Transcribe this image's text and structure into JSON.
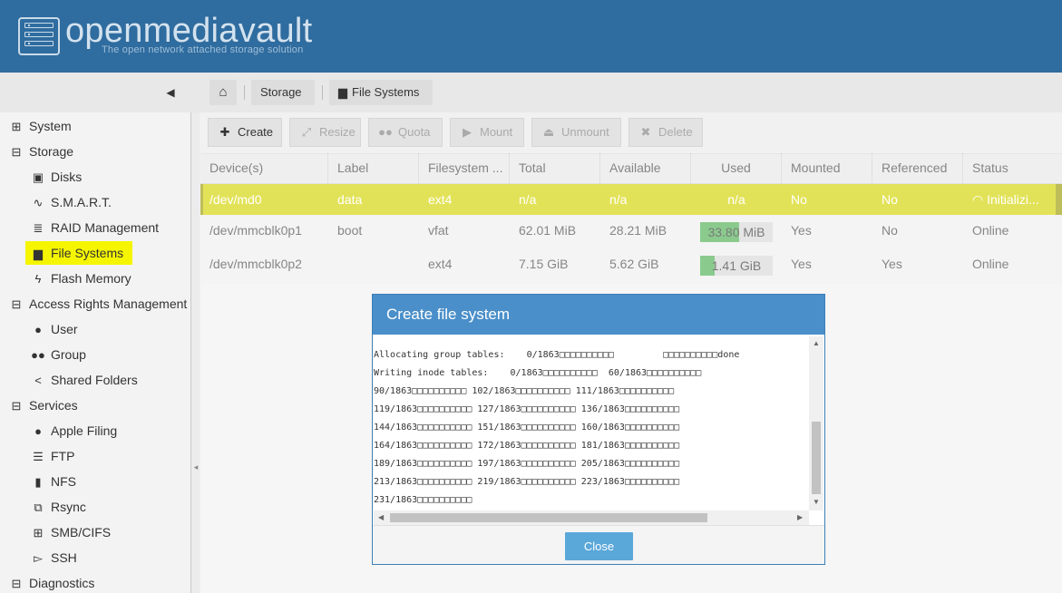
{
  "app": {
    "title": "openmediavault",
    "subtitle": "The open network attached storage solution"
  },
  "breadcrumb": {
    "home_icon": "home-icon",
    "items": [
      "Storage",
      "File Systems"
    ]
  },
  "sidebar": {
    "items": [
      {
        "label": "System",
        "icon": "expand-plus-icon"
      },
      {
        "label": "Storage",
        "icon": "collapse-minus-icon"
      },
      {
        "label": "Disks",
        "icon": "disk-icon"
      },
      {
        "label": "S.M.A.R.T.",
        "icon": "pulse-icon"
      },
      {
        "label": "RAID Management",
        "icon": "database-icon"
      },
      {
        "label": "File Systems",
        "icon": "folder-icon",
        "selected": true
      },
      {
        "label": "Flash Memory",
        "icon": "lightning-icon"
      },
      {
        "label": "Access Rights Management",
        "icon": "collapse-minus-icon"
      },
      {
        "label": "User",
        "icon": "user-icon"
      },
      {
        "label": "Group",
        "icon": "group-icon"
      },
      {
        "label": "Shared Folders",
        "icon": "share-icon"
      },
      {
        "label": "Services",
        "icon": "collapse-minus-icon"
      },
      {
        "label": "Apple Filing",
        "icon": "apple-icon"
      },
      {
        "label": "FTP",
        "icon": "server-icon"
      },
      {
        "label": "NFS",
        "icon": "nfs-icon"
      },
      {
        "label": "Rsync",
        "icon": "rsync-icon"
      },
      {
        "label": "SMB/CIFS",
        "icon": "windows-icon"
      },
      {
        "label": "SSH",
        "icon": "terminal-icon"
      },
      {
        "label": "Diagnostics",
        "icon": "collapse-minus-icon"
      }
    ]
  },
  "toolbar": {
    "create": "Create",
    "resize": "Resize",
    "quota": "Quota",
    "mount": "Mount",
    "unmount": "Unmount",
    "delete": "Delete"
  },
  "grid": {
    "columns": [
      "Device(s)",
      "Label",
      "Filesystem ...",
      "Total",
      "Available",
      "Used",
      "Mounted",
      "Referenced",
      "Status"
    ],
    "rows": [
      {
        "device": "/dev/md0",
        "label": "data",
        "fs": "ext4",
        "total": "n/a",
        "available": "n/a",
        "used": "n/a",
        "used_pct": 0,
        "mounted": "No",
        "referenced": "No",
        "status": "Initializi..."
      },
      {
        "device": "/dev/mmcblk0p1",
        "label": "boot",
        "fs": "vfat",
        "total": "62.01 MiB",
        "available": "28.21 MiB",
        "used": "33.80 MiB",
        "used_pct": 54,
        "mounted": "Yes",
        "referenced": "No",
        "status": "Online"
      },
      {
        "device": "/dev/mmcblk0p2",
        "label": "",
        "fs": "ext4",
        "total": "7.15 GiB",
        "available": "5.62 GiB",
        "used": "1.41 GiB",
        "used_pct": 20,
        "mounted": "Yes",
        "referenced": "Yes",
        "status": "Online"
      }
    ]
  },
  "colors": {
    "header": "#2f6c9f",
    "highlight": "#f5f500",
    "used_bar": "#4caf50",
    "dialog_title": "#4a8fc9",
    "close_button": "#5aa7d9"
  },
  "dialog": {
    "title": "Create file system",
    "log": [
      "Allocating group tables:    0/1863□□□□□□□□□□         □□□□□□□□□□done",
      "Writing inode tables:    0/1863□□□□□□□□□□  60/1863□□□□□□□□□□",
      "90/1863□□□□□□□□□□ 102/1863□□□□□□□□□□ 111/1863□□□□□□□□□□",
      "119/1863□□□□□□□□□□ 127/1863□□□□□□□□□□ 136/1863□□□□□□□□□□",
      "144/1863□□□□□□□□□□ 151/1863□□□□□□□□□□ 160/1863□□□□□□□□□□",
      "164/1863□□□□□□□□□□ 172/1863□□□□□□□□□□ 181/1863□□□□□□□□□□",
      "189/1863□□□□□□□□□□ 197/1863□□□□□□□□□□ 205/1863□□□□□□□□□□",
      "213/1863□□□□□□□□□□ 219/1863□□□□□□□□□□ 223/1863□□□□□□□□□□",
      "231/1863□□□□□□□□□□"
    ],
    "close_label": "Close"
  }
}
